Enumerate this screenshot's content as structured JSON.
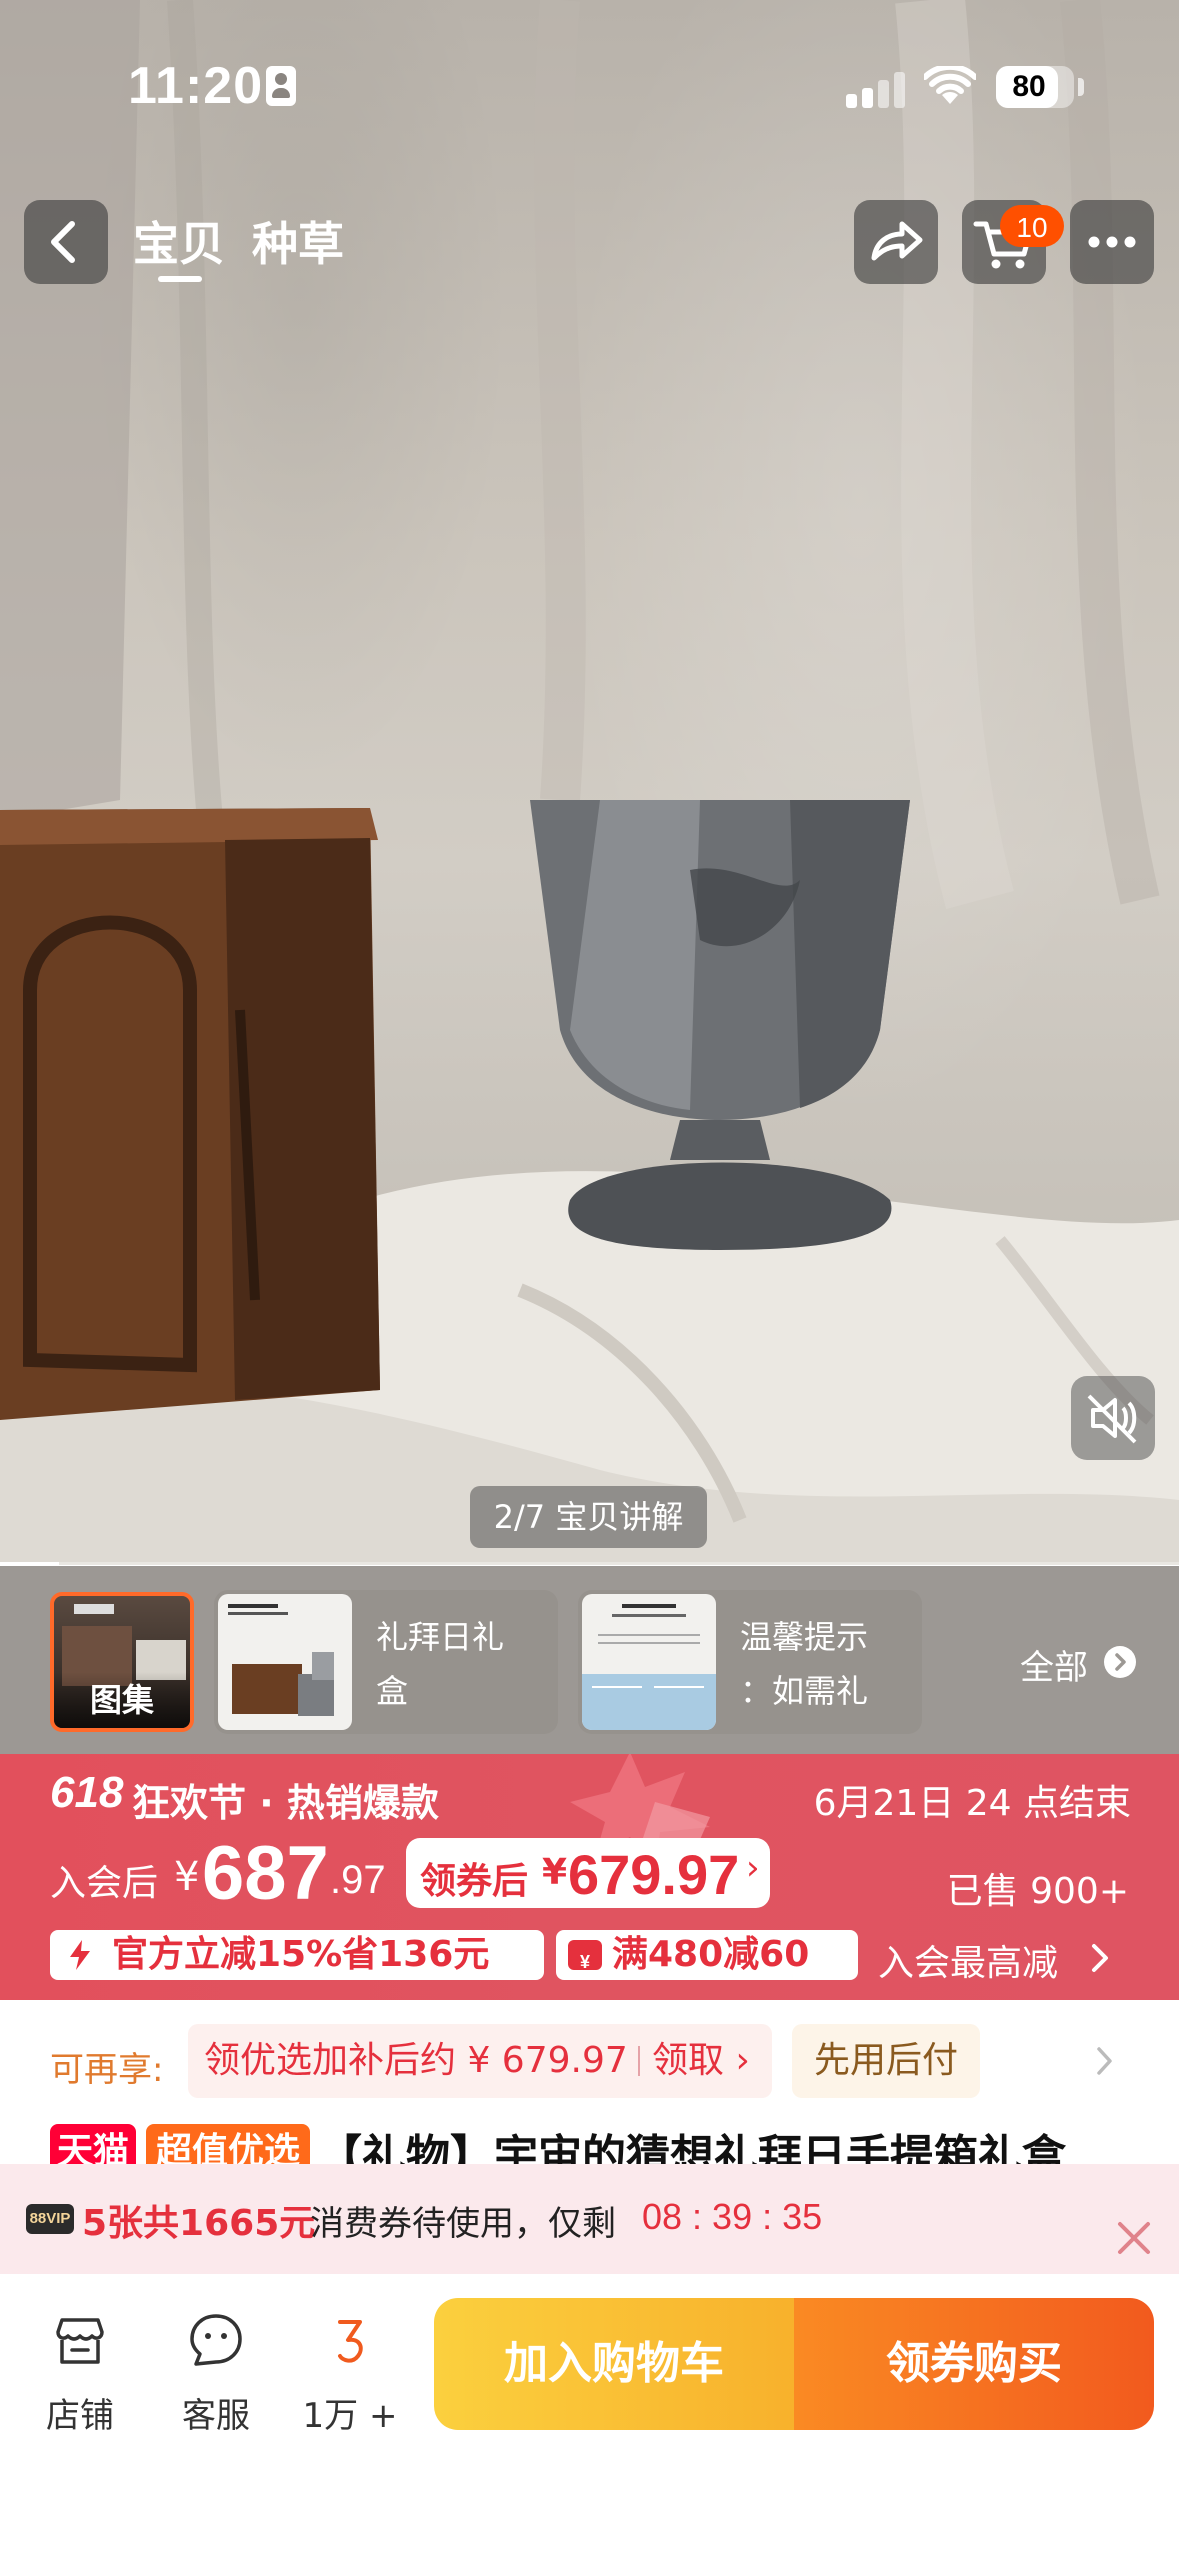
{
  "status_bar": {
    "time": "11:20",
    "battery": "80",
    "battery_level": 0.8
  },
  "nav": {
    "tabs": [
      "宝贝",
      "种草"
    ],
    "active_tab": "宝贝",
    "cart_count": "10"
  },
  "gallery": {
    "page_indicator": "2/7 宝贝讲解",
    "progress": 0.05,
    "thumbnails": [
      {
        "label": "图集",
        "selected": true
      },
      {
        "label": "礼拜日礼盒"
      },
      {
        "label": "温馨提示：如需礼"
      }
    ],
    "thumb_text_lines": [
      [
        "礼拜日礼",
        "盒"
      ],
      [
        "温馨提示",
        "：如需礼"
      ]
    ],
    "all_label": "全部"
  },
  "promo": {
    "event_num": "618",
    "event_title": "狂欢节 · 热销爆款",
    "end_text": "6月21日 24 点结束",
    "member_price_prefix": "入会后",
    "currency": "¥",
    "member_price_int": "687",
    "member_price_dec": ".97",
    "coupon_label": "领券后",
    "coupon_price": "679.97",
    "sold": "已售 900+",
    "discount_tag": "官方立减15%省136元",
    "full_reduce_tag": "满480减60",
    "member_max": "入会最高减",
    "colors": {
      "banner": "#e0525f",
      "accent": "#e5303d"
    }
  },
  "extras": {
    "label": "可再享:",
    "subsidy": "领优选加补后约 ¥ 679.97",
    "claim": "领取 ›",
    "pay_later": "先用后付"
  },
  "title": {
    "tmall_tag": "天猫",
    "value_tag": "超值优选",
    "text": "【礼物】宇宙的猜想礼拜日手提箱礼盒"
  },
  "vip": {
    "badge": "88VIP",
    "count": "5张共1665元",
    "text": "消费券待使用，仅剩",
    "timer": "08 : 39 : 35"
  },
  "bottom": {
    "store": "店铺",
    "service": "客服",
    "fav": "1万 +",
    "add_cart": "加入购物车",
    "buy": "领券购买",
    "colors": {
      "cart": "#f9bf33",
      "buy": "#f46a20"
    }
  }
}
